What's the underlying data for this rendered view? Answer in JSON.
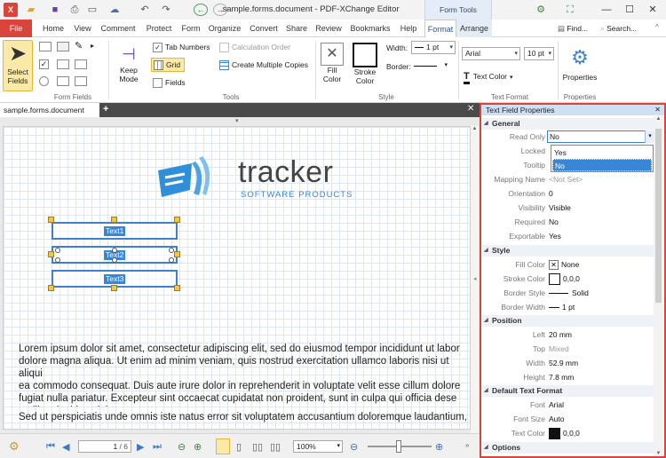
{
  "window": {
    "title": "sample.forms.document - PDF-XChange Editor",
    "context_tab_group": "Form Tools",
    "quick_access_icons": [
      "folder-open-icon",
      "save-icon",
      "print-icon",
      "scan-icon",
      "undo-icon",
      "redo-icon",
      "back-icon",
      "forward-icon"
    ]
  },
  "tabs": [
    {
      "label": "File"
    },
    {
      "label": "Home"
    },
    {
      "label": "View"
    },
    {
      "label": "Comment"
    },
    {
      "label": "Protect"
    },
    {
      "label": "Form"
    },
    {
      "label": "Organize"
    },
    {
      "label": "Convert"
    },
    {
      "label": "Share"
    },
    {
      "label": "Review"
    },
    {
      "label": "Bookmarks"
    },
    {
      "label": "Help"
    },
    {
      "label": "Format"
    },
    {
      "label": "Arrange"
    }
  ],
  "tab_right": {
    "find": "Find...",
    "search": "Search..."
  },
  "ribbon": {
    "select_fields": {
      "line1": "Select",
      "line2": "Fields"
    },
    "keep_mode": {
      "line1": "Keep",
      "line2": "Mode"
    },
    "tab_numbers": "Tab Numbers",
    "calc_order": "Calculation Order",
    "grid": "Grid",
    "create_multiple": "Create Multiple Copies",
    "fields": "Fields",
    "width_label": "Width:",
    "width_value": "1 pt",
    "border_label": "Border:",
    "fill_color": {
      "line1": "Fill",
      "line2": "Color"
    },
    "stroke_color": {
      "line1": "Stroke",
      "line2": "Color"
    },
    "font_value": "Arial",
    "font_size_value": "10 pt",
    "text_color": "Text Color",
    "properties": "Properties",
    "groups": {
      "form_fields": "Form Fields",
      "tools": "Tools",
      "style": "Style",
      "text_format": "Text Format",
      "properties": "Properties"
    }
  },
  "document": {
    "tab_name": "sample.forms.document",
    "logo": {
      "word": "tracker",
      "sub": "SOFTWARE PRODUCTS"
    },
    "fields": [
      {
        "label": "Text1"
      },
      {
        "label": "Text2"
      },
      {
        "label": "Text3"
      }
    ],
    "paragraph1": "Lorem ipsum dolor sit amet, consectetur adipiscing elit, sed do eiusmod tempor incididunt ut labor\ndolore magna aliqua. Ut enim ad minim veniam, quis nostrud exercitation ullamco laboris nisi ut aliqui\nea commodo consequat. Duis aute irure dolor in reprehenderit in voluptate velit esse cillum dolore\nfugiat nulla pariatur. Excepteur sint occaecat cupidatat non proident, sunt in culpa qui officia dese\nmollit anim id est laborum.",
    "paragraph2": "Sed ut perspiciatis unde omnis iste natus error sit voluptatem accusantium doloremque laudantium, to"
  },
  "statusbar": {
    "page_value": "1",
    "page_total": "/ 6",
    "zoom": "100%"
  },
  "panel": {
    "title": "Text Field Properties",
    "sections": {
      "general": "General",
      "style": "Style",
      "position": "Position",
      "default_text_format": "Default Text Format",
      "options": "Options"
    },
    "general": [
      {
        "label": "Read Only",
        "value": "No"
      },
      {
        "label": "Locked",
        "value": ""
      },
      {
        "label": "Tooltip",
        "value": ""
      },
      {
        "label": "Mapping Name",
        "value": "<Not Set>"
      },
      {
        "label": "Orientation",
        "value": "0"
      },
      {
        "label": "Visibility",
        "value": "Visible"
      },
      {
        "label": "Required",
        "value": "No"
      },
      {
        "label": "Exportable",
        "value": "Yes"
      }
    ],
    "dropdown_options": [
      "Yes",
      "No"
    ],
    "style": [
      {
        "label": "Fill Color",
        "value": "None"
      },
      {
        "label": "Stroke Color",
        "value": "0,0,0"
      },
      {
        "label": "Border Style",
        "value": "Solid"
      },
      {
        "label": "Border Width",
        "value": "1 pt"
      }
    ],
    "position": [
      {
        "label": "Left",
        "value": "20 mm"
      },
      {
        "label": "Top",
        "value": "Mixed"
      },
      {
        "label": "Width",
        "value": "52.9 mm"
      },
      {
        "label": "Height",
        "value": "7.8 mm"
      }
    ],
    "text_format": [
      {
        "label": "Font",
        "value": "Arial"
      },
      {
        "label": "Font Size",
        "value": "Auto"
      },
      {
        "label": "Text Color",
        "value": "0,0,0"
      }
    ]
  },
  "colors": {
    "accent": "#d9453a",
    "selection": "#3a86d6",
    "ribbon_highlight": "#fbe9a8",
    "logo_blue": "#2f8fd8"
  }
}
